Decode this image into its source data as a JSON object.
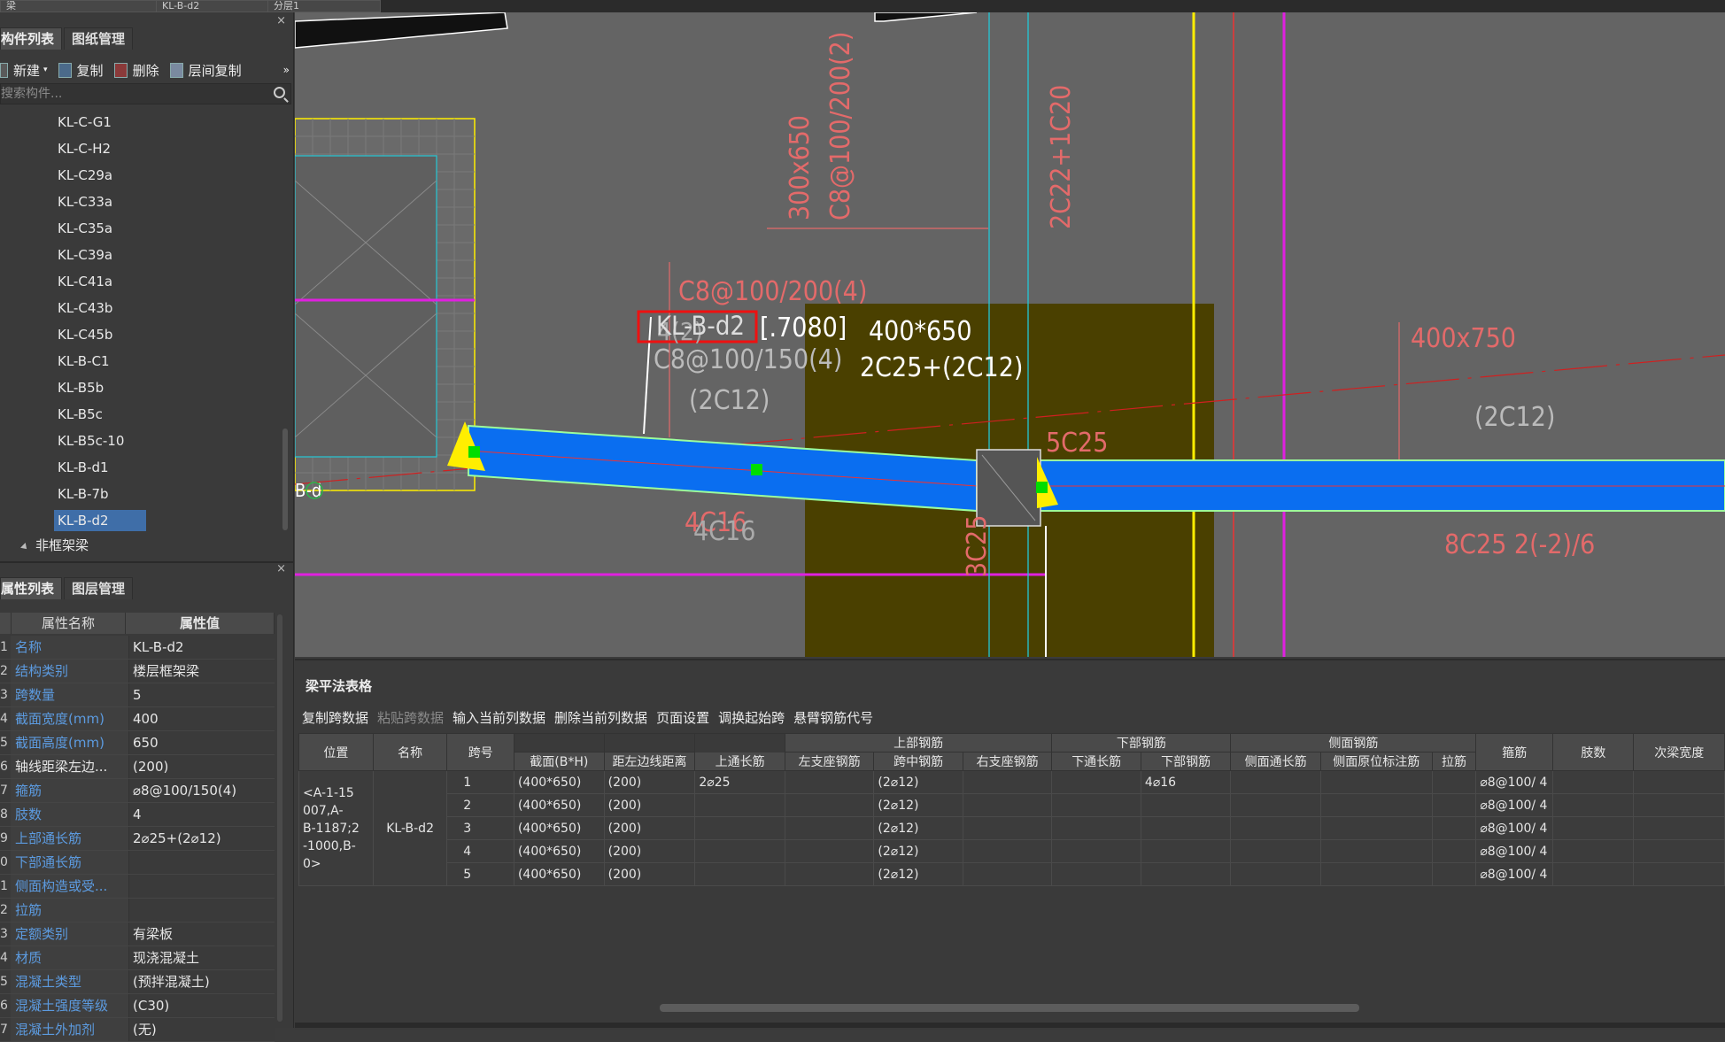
{
  "topbar": {
    "field1": "梁",
    "field2": "KL-B-d2",
    "field3": "分层1"
  },
  "component_panel": {
    "tabs": [
      "构件列表",
      "图纸管理"
    ],
    "close": "×",
    "toolbar": {
      "new_label": "新建",
      "copy_label": "复制",
      "delete_label": "删除",
      "floor_copy_label": "层间复制",
      "more": "»"
    },
    "search_placeholder": "搜索构件...",
    "items": [
      "KL-C-G1",
      "KL-C-H2",
      "KL-C29a",
      "KL-C33a",
      "KL-C35a",
      "KL-C39a",
      "KL-C41a",
      "KL-C43b",
      "KL-C45b",
      "KL-B-C1",
      "KL-B5b",
      "KL-B5c",
      "KL-B5c-10",
      "KL-B-d1",
      "KL-B-7b",
      "KL-B-d2"
    ],
    "selected": "KL-B-d2",
    "group_label": "非框架梁"
  },
  "property_panel": {
    "tabs": [
      "属性列表",
      "图层管理"
    ],
    "close": "×",
    "col_name": "属性名称",
    "col_value": "属性值",
    "rows": [
      {
        "n": "1",
        "k": "名称",
        "v": "KL-B-d2",
        "blue": true
      },
      {
        "n": "2",
        "k": "结构类别",
        "v": "楼层框架梁",
        "blue": true
      },
      {
        "n": "3",
        "k": "跨数量",
        "v": "5",
        "blue": true
      },
      {
        "n": "4",
        "k": "截面宽度(mm)",
        "v": "400",
        "blue": true
      },
      {
        "n": "5",
        "k": "截面高度(mm)",
        "v": "650",
        "blue": true
      },
      {
        "n": "6",
        "k": "轴线距梁左边...",
        "v": "(200)",
        "blue": false
      },
      {
        "n": "7",
        "k": "箍筋",
        "v": "⌀8@100/150(4)",
        "blue": true
      },
      {
        "n": "8",
        "k": "肢数",
        "v": "4",
        "blue": true
      },
      {
        "n": "9",
        "k": "上部通长筋",
        "v": "2⌀25+(2⌀12)",
        "blue": true
      },
      {
        "n": "0",
        "k": "下部通长筋",
        "v": "",
        "blue": true
      },
      {
        "n": "1",
        "k": "侧面构造或受...",
        "v": "",
        "blue": true
      },
      {
        "n": "2",
        "k": "拉筋",
        "v": "",
        "blue": true
      },
      {
        "n": "3",
        "k": "定额类别",
        "v": "有梁板",
        "blue": true
      },
      {
        "n": "4",
        "k": "材质",
        "v": "现浇混凝土",
        "blue": true
      },
      {
        "n": "5",
        "k": "混凝土类型",
        "v": "(预拌混凝土)",
        "blue": true
      },
      {
        "n": "6",
        "k": "混凝土强度等级",
        "v": "(C30)",
        "blue": true
      },
      {
        "n": "7",
        "k": "混凝土外加剂",
        "v": "(无)",
        "blue": true
      }
    ]
  },
  "canvas": {
    "labels": {
      "stirrup_top": "C8@100/200(2)",
      "section_top": "300x650",
      "top_bars": "2C22+1C20",
      "stirrup_mid": "C8@100/200(4)",
      "beam_name_overlap": "KL-B-d2",
      "span_tag": "[.7080]",
      "beam_section": "400*650",
      "stirrup_main": "C8@100/150(4)",
      "main_bars": "2C25+(2C12)",
      "waist_left": "(2C12)",
      "ghost_label": "4(2)",
      "section_right": "400x750",
      "waist_right": "(2C12)",
      "support_bars": "5C25",
      "bottom_bars": "4C16",
      "bottom_ghost": "4C16",
      "column_bars": "3C25",
      "right_bottom_bars": "8C25 2(-2)/6",
      "axis_tag": "B-d"
    }
  },
  "bottom_panel": {
    "title": "梁平法表格",
    "toolbar": [
      "复制跨数据",
      "粘贴跨数据",
      "输入当前列数据",
      "删除当前列数据",
      "页面设置",
      "调换起始跨",
      "悬臂钢筋代号"
    ],
    "toolbar_disabled": [
      false,
      true,
      false,
      false,
      false,
      false,
      false
    ],
    "group_headers": {
      "top_rebar": "上部钢筋",
      "bottom_rebar": "下部钢筋",
      "side_rebar": "侧面钢筋"
    },
    "headers": {
      "position": "位置",
      "name": "名称",
      "span": "跨号",
      "section": "截面(B*H)",
      "offset": "距左边线距离",
      "top_through": "上通长筋",
      "left_support": "左支座钢筋",
      "mid_span": "跨中钢筋",
      "right_support": "右支座钢筋",
      "bottom_through": "下通长筋",
      "bottom_rebar": "下部钢筋",
      "side_through": "侧面通长筋",
      "side_original": "侧面原位标注筋",
      "tie": "拉筋",
      "stirrup": "箍筋",
      "legs": "肢数",
      "sec_width": "次梁宽度"
    },
    "position_text": "<A-1-15\n007,A-\nB-1187;2\n-1000,B-\n0>",
    "name_text": "KL-B-d2",
    "rows": [
      {
        "idx": "1",
        "span": "1",
        "section": "(400*650)",
        "offset": "(200)",
        "top_through": "2⌀25",
        "left_support": "",
        "mid_span": "(2⌀12)",
        "right_support": "",
        "bottom_through": "",
        "bottom_rebar": "4⌀16",
        "side_through": "",
        "side_original": "",
        "tie": "",
        "stirrup": "⌀8@100/ 4",
        "legs": "",
        "sec_width": ""
      },
      {
        "idx": "2",
        "span": "2",
        "section": "(400*650)",
        "offset": "(200)",
        "top_through": "",
        "left_support": "",
        "mid_span": "(2⌀12)",
        "right_support": "",
        "bottom_through": "",
        "bottom_rebar": "",
        "side_through": "",
        "side_original": "",
        "tie": "",
        "stirrup": "⌀8@100/ 4",
        "legs": "",
        "sec_width": ""
      },
      {
        "idx": "3",
        "span": "3",
        "section": "(400*650)",
        "offset": "(200)",
        "top_through": "",
        "left_support": "",
        "mid_span": "(2⌀12)",
        "right_support": "",
        "bottom_through": "",
        "bottom_rebar": "",
        "side_through": "",
        "side_original": "",
        "tie": "",
        "stirrup": "⌀8@100/ 4",
        "legs": "",
        "sec_width": ""
      },
      {
        "idx": "4",
        "span": "4",
        "section": "(400*650)",
        "offset": "(200)",
        "top_through": "",
        "left_support": "",
        "mid_span": "(2⌀12)",
        "right_support": "",
        "bottom_through": "",
        "bottom_rebar": "",
        "side_through": "",
        "side_original": "",
        "tie": "",
        "stirrup": "⌀8@100/ 4",
        "legs": "",
        "sec_width": ""
      },
      {
        "idx": "5",
        "span": "5",
        "section": "(400*650)",
        "offset": "(200)",
        "top_through": "",
        "left_support": "",
        "mid_span": "(2⌀12)",
        "right_support": "",
        "bottom_through": "",
        "bottom_rebar": "",
        "side_through": "",
        "side_original": "",
        "tie": "",
        "stirrup": "⌀8@100/ 4",
        "legs": "",
        "sec_width": ""
      }
    ]
  },
  "colors": {
    "beam_fill": "#0a6ef0",
    "canvas_bg": "#646464",
    "column_zone": "#4a4000",
    "dim_red": "#e36a6a",
    "yellow": "#ffee00",
    "magenta": "#e020e0",
    "cyan": "#24c8d6",
    "selection": "#3f6ea8",
    "prop_key_blue": "#5c9be0"
  }
}
